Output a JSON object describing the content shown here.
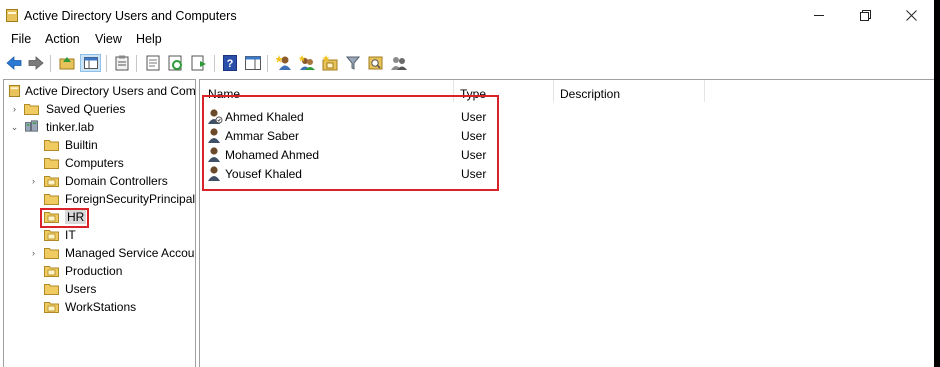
{
  "window": {
    "title": "Active Directory Users and Computers"
  },
  "menu": [
    "File",
    "Action",
    "View",
    "Help"
  ],
  "toolbar_icons": [
    "back-arrow-icon",
    "forward-arrow-icon",
    "up-folder-icon",
    "console-tree-icon",
    "properties-icon",
    "export-icon",
    "refresh-icon",
    "export-list-icon",
    "help-icon",
    "show-action-pane-icon",
    "new-user-icon",
    "new-group-icon",
    "new-ou-icon",
    "filter-icon",
    "find-icon",
    "add-to-group-icon"
  ],
  "tree": {
    "root": "Active Directory Users and Computers",
    "items": [
      {
        "label": "Saved Queries"
      },
      {
        "label": "tinker.lab"
      },
      {
        "label": "Builtin"
      },
      {
        "label": "Computers"
      },
      {
        "label": "Domain Controllers"
      },
      {
        "label": "ForeignSecurityPrincipals"
      },
      {
        "label": "HR"
      },
      {
        "label": "IT"
      },
      {
        "label": "Managed Service Accounts"
      },
      {
        "label": "Production"
      },
      {
        "label": "Users"
      },
      {
        "label": "WorkStations"
      }
    ]
  },
  "list": {
    "columns": [
      "Name",
      "Type",
      "Description"
    ],
    "rows": [
      {
        "name": "Ahmed Khaled",
        "type": "User"
      },
      {
        "name": "Ammar Saber",
        "type": "User"
      },
      {
        "name": "Mohamed Ahmed",
        "type": "User"
      },
      {
        "name": "Yousef Khaled",
        "type": "User"
      }
    ]
  },
  "colors": {
    "highlight": "#d9232a",
    "folder": "#e8c25a"
  }
}
